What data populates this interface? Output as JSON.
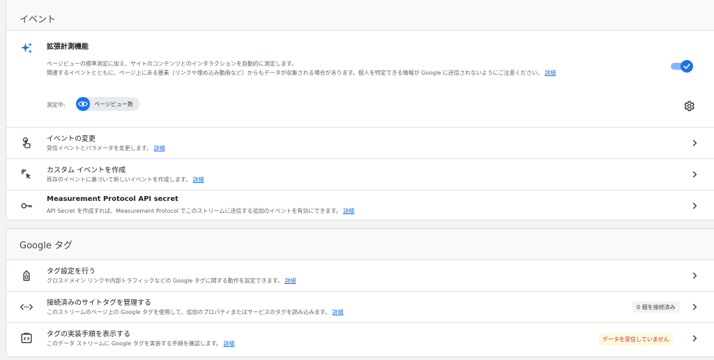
{
  "colors": {
    "accent": "#1a73e8",
    "link": "#1a73e8",
    "warning_text": "#d93025",
    "warning_bg": "#fef7e0"
  },
  "events": {
    "section_title": "イベント",
    "enhanced": {
      "title": "拡張計測機能",
      "desc_line1": "ページビューの標準測定に加え、サイトのコンテンツとのインタラクションを自動的に測定します。",
      "desc_line2": "関連するイベントとともに、ページ上にある要素（リンクや埋め込み動画など）からもデータが収集される場合があります。個人を特定できる情報が Google に送信されないようにご注意ください。",
      "link": "詳細",
      "toggle_on": true,
      "measuring_label": "測定中:",
      "chip_label": "ページビュー数",
      "icon": "sparkle-icon"
    },
    "rows": [
      {
        "title": "イベントの変更",
        "desc": "受信イベントとパラメータを変更します。",
        "link": "詳細",
        "icon": "touch-icon"
      },
      {
        "title": "カスタム イベントを作成",
        "desc": "既存のイベントに基づいて新しいイベントを作成します。",
        "link": "詳細",
        "icon": "click-sparkle-icon"
      },
      {
        "title": "Measurement Protocol API secret",
        "desc": "API Secret を作成すれば、Measurement Protocol でこのストリームに送信する追加のイベントを有効にできます。",
        "link": "詳細",
        "icon": "key-icon"
      }
    ]
  },
  "google_tag": {
    "section_title": "Google タグ",
    "rows": [
      {
        "title": "タグ設定を行う",
        "desc": "クロスドメイン リンクや内部トラフィックなどの Google タグに関する動作を設定できます。",
        "link": "詳細",
        "icon": "tag-icon"
      },
      {
        "title": "接続済みのサイトタグを管理する",
        "desc": "このストリームのページ上の Google タグを使用して、追加のプロパティまたはサービスのタグを読み込みます。",
        "link": "詳細",
        "icon": "code-arrows-icon",
        "badge": "0 個を接続済み"
      },
      {
        "title": "タグの実装手順を表示する",
        "desc": "このデータ ストリームに Google タグを実装する手順を確認します。",
        "link": "詳細",
        "icon": "code-box-icon",
        "status": "データを受信していません"
      }
    ]
  }
}
